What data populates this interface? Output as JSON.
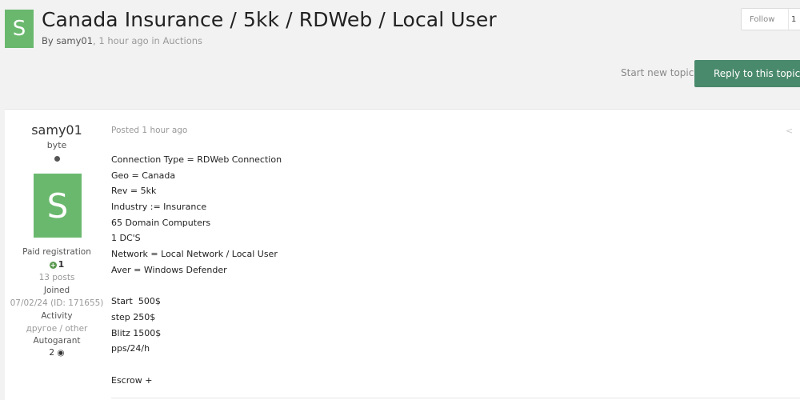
{
  "topic": {
    "avatar_letter": "S",
    "title": "Canada Insurance / 5kk / RDWeb / Local User",
    "meta_by": "By",
    "meta_author": "samy01",
    "meta_time": ", 1 hour ago in",
    "meta_forum": "Auctions"
  },
  "follow": {
    "label": "Follow",
    "count": "1"
  },
  "actions": {
    "start_new_topic": "Start new topic",
    "reply": "Reply to this topic"
  },
  "author": {
    "name": "samy01",
    "rank": "byte",
    "avatar_letter": "S",
    "group": "Paid registration",
    "reputation": "1",
    "posts": "13 posts",
    "joined_label": "Joined",
    "joined_value": "07/02/24 (ID: 171655)",
    "activity_label": "Activity",
    "activity_value": "другое / other",
    "autogarant_label": "Autogarant",
    "autogarant_value": "2"
  },
  "post": {
    "posted": "Posted 1 hour ago",
    "lines": [
      "Connection Type = RDWeb Connection",
      "Geo = Canada",
      "Rev = 5kk",
      "Industry := Insurance",
      "65 Domain Computers",
      "1 DC'S",
      "Network = Local Network / Local User",
      "Aver = Windows Defender",
      "",
      "Start  500$",
      "step 250$",
      "Blitz 1500$",
      "pps/24/h",
      "",
      "Escrow +"
    ]
  },
  "colors": {
    "avatar_green": "#6ab86e",
    "reply_button": "#4a8a6c"
  },
  "icons": {
    "share": "share-icon",
    "reputation": "plus-circle-icon",
    "handshake": "handshake-icon"
  }
}
